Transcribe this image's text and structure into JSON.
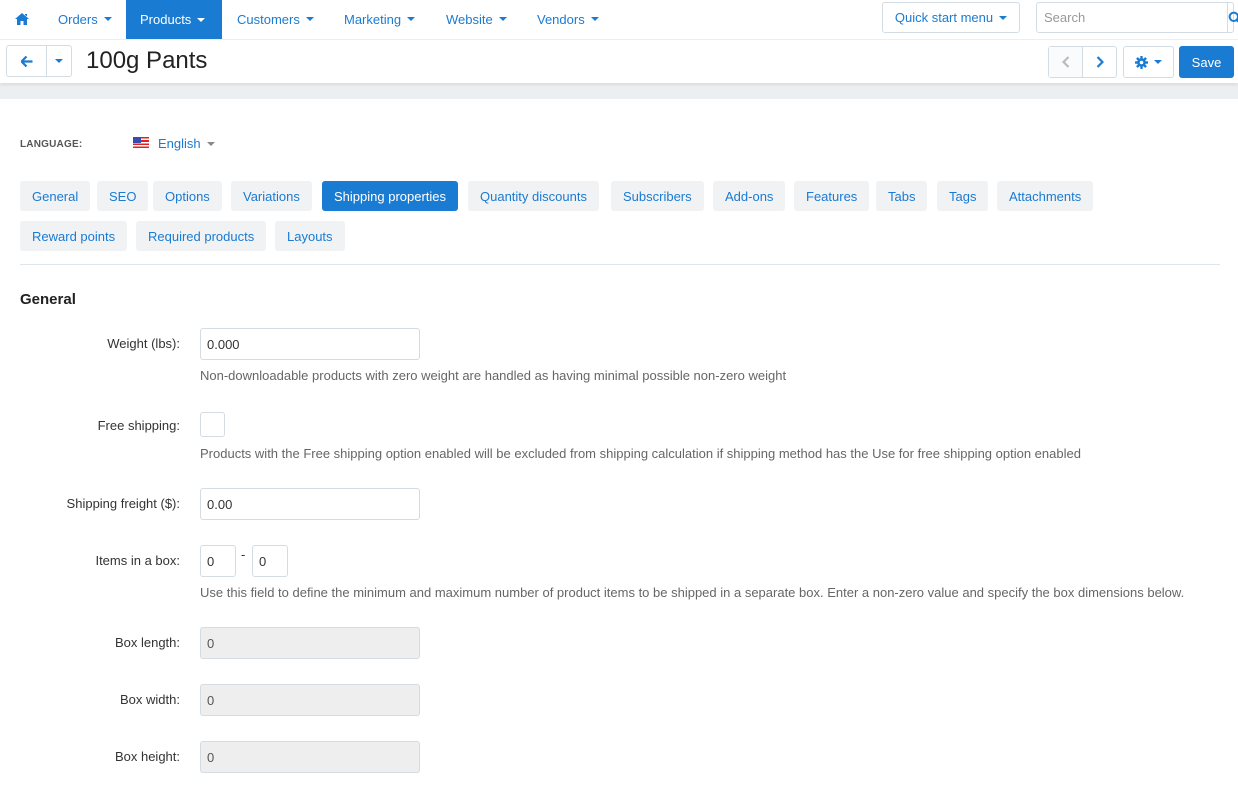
{
  "topnav": {
    "home_icon": "home-icon",
    "items": [
      {
        "label": "Orders",
        "active": false
      },
      {
        "label": "Products",
        "active": true
      },
      {
        "label": "Customers",
        "active": false
      },
      {
        "label": "Marketing",
        "active": false
      },
      {
        "label": "Website",
        "active": false
      },
      {
        "label": "Vendors",
        "active": false
      }
    ],
    "quick_start_label": "Quick start menu",
    "search": {
      "placeholder": "Search",
      "value": ""
    }
  },
  "titlebar": {
    "title": "100g Pants",
    "save_label": "Save"
  },
  "language": {
    "label": "LANGUAGE:",
    "selected": "English"
  },
  "tabs": [
    {
      "label": "General",
      "active": false
    },
    {
      "label": "SEO",
      "active": false
    },
    {
      "label": "Options",
      "active": false
    },
    {
      "label": "Variations",
      "active": false
    },
    {
      "label": "Shipping properties",
      "active": true
    },
    {
      "label": "Quantity discounts",
      "active": false
    },
    {
      "label": "Subscribers",
      "active": false
    },
    {
      "label": "Add-ons",
      "active": false
    },
    {
      "label": "Features",
      "active": false
    },
    {
      "label": "Tabs",
      "active": false
    },
    {
      "label": "Tags",
      "active": false
    },
    {
      "label": "Attachments",
      "active": false
    },
    {
      "label": "Reward points",
      "active": false
    },
    {
      "label": "Required products",
      "active": false
    },
    {
      "label": "Layouts",
      "active": false
    }
  ],
  "section": {
    "title": "General",
    "fields": {
      "weight": {
        "label": "Weight (lbs):",
        "value": "0.000",
        "help": "Non-downloadable products with zero weight are handled as having minimal possible non-zero weight"
      },
      "free_shipping": {
        "label": "Free shipping:",
        "checked": false,
        "help": "Products with the Free shipping option enabled will be excluded from shipping calculation if shipping method has the Use for free shipping option enabled"
      },
      "shipping_freight": {
        "label": "Shipping freight ($):",
        "value": "0.00"
      },
      "items_in_box": {
        "label": "Items in a box:",
        "min": "0",
        "max": "0",
        "separator": "-",
        "help": "Use this field to define the minimum and maximum number of product items to be shipped in a separate box. Enter a non-zero value and specify the box dimensions below."
      },
      "box_length": {
        "label": "Box length:",
        "value": "0"
      },
      "box_width": {
        "label": "Box width:",
        "value": "0"
      },
      "box_height": {
        "label": "Box height:",
        "value": "0"
      }
    }
  },
  "colors": {
    "accent": "#1a7bd2",
    "tab_bg": "#f1f2f4",
    "disabled_field_bg": "#eeeeee",
    "band": "#eceff1"
  }
}
